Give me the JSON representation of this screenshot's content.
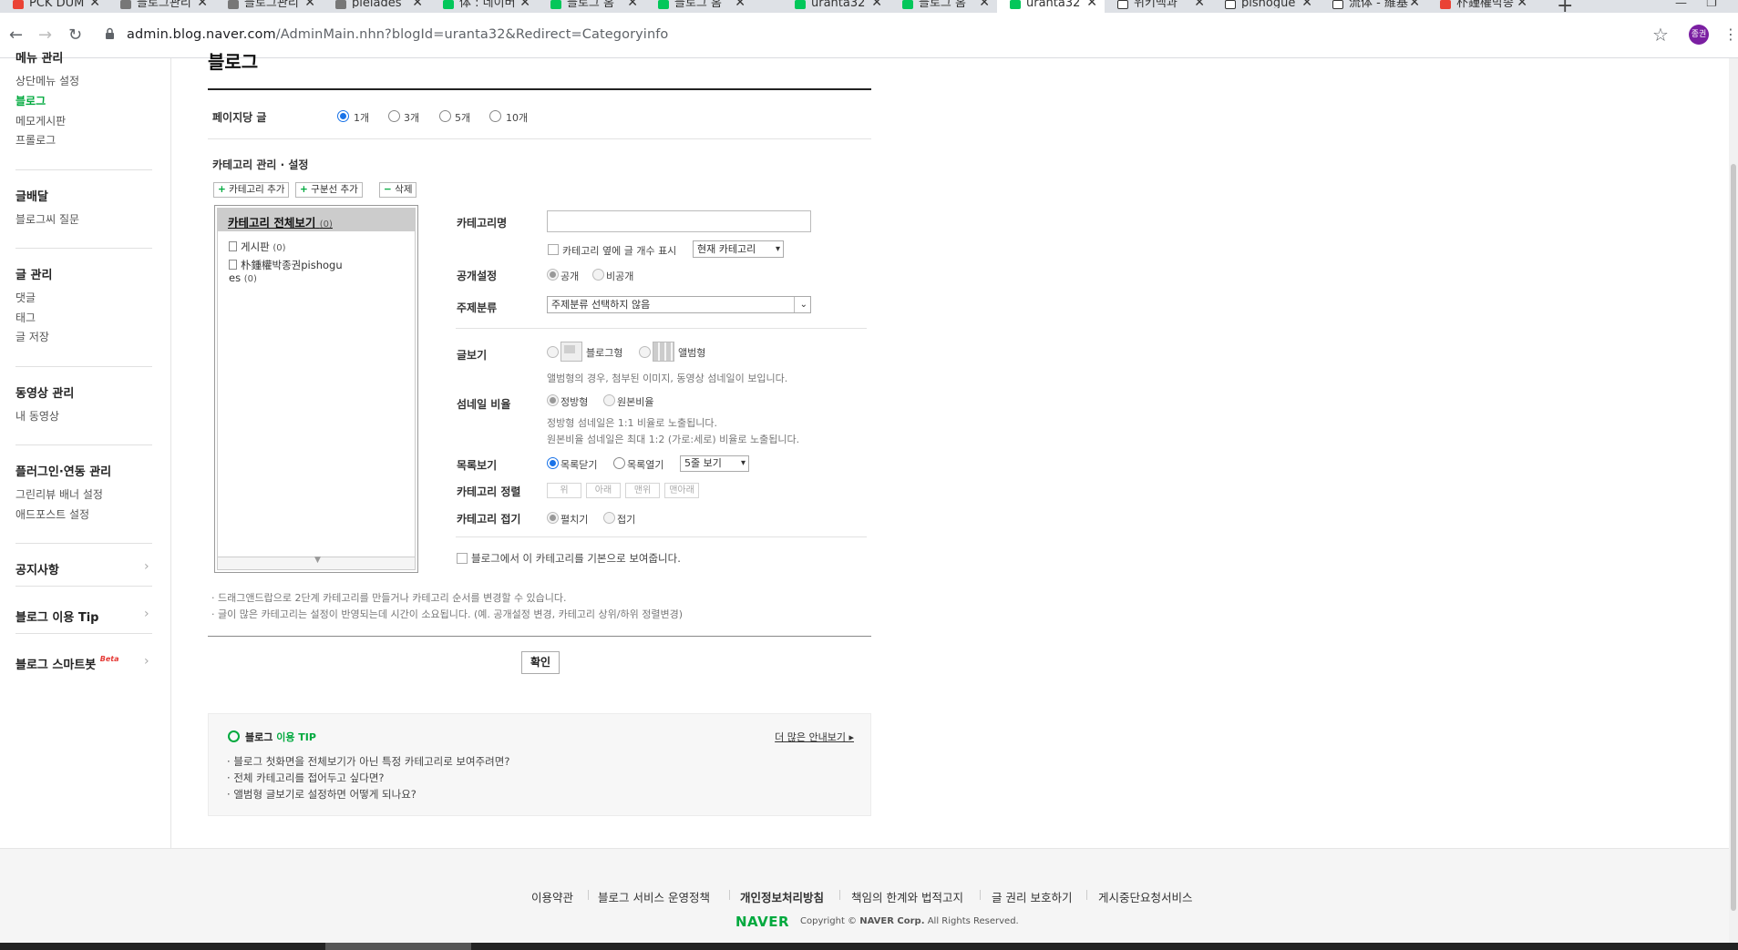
{
  "browser": {
    "tabs": [
      {
        "title": "PCK DUM",
        "favicon_color": "#ea4335"
      },
      {
        "title": "블로그관리",
        "favicon_color": "#666666"
      },
      {
        "title": "블로그관리",
        "favicon_color": "#666666"
      },
      {
        "title": "pleiades",
        "favicon_color": "#666666"
      },
      {
        "title": "体 : 네이버",
        "favicon_color": "#03c75a"
      },
      {
        "title": "블로그 홈",
        "favicon_color": "#03c75a"
      },
      {
        "title": "블로그 홈",
        "favicon_color": "#03c75a"
      },
      {
        "title": "uranta32",
        "favicon_color": "#03c75a"
      },
      {
        "title": "블로그 홈",
        "favicon_color": "#03c75a"
      },
      {
        "title": "uranta32",
        "favicon_color": "#03c75a"
      },
      {
        "title": "위키백과",
        "favicon_color": "#333333"
      },
      {
        "title": "pishogue",
        "favicon_color": "#333333"
      },
      {
        "title": "流体 - 維基",
        "favicon_color": "#333333"
      },
      {
        "title": "朴鍾權박종",
        "favicon_color": "#ea4335"
      }
    ],
    "active_tab_index": 9,
    "url_prefix": "admin.blog.naver.com",
    "url_rest": "/AdminMain.nhn?blogId=uranta32&Redirect=Categoryinfo",
    "profile_label": "종권"
  },
  "sidebar": {
    "section_menu": {
      "heading": "메뉴 관리",
      "items": [
        "상단메뉴 설정",
        "블로그",
        "메모게시판",
        "프롤로그"
      ]
    },
    "section_deliver": {
      "heading": "글배달",
      "items": [
        "블로그씨 질문"
      ]
    },
    "section_posts": {
      "heading": "글 관리",
      "items": [
        "댓글",
        "태그",
        "글 저장"
      ]
    },
    "section_video": {
      "heading": "동영상 관리",
      "items": [
        "내 동영상"
      ]
    },
    "section_plugin": {
      "heading": "플러그인·연동 관리",
      "items": [
        "그린리뷰 배너 설정",
        "애드포스트 설정"
      ]
    },
    "notice": "공지사항",
    "tip": "블로그 이용 Tip",
    "smartbot": "블로그 스마트봇",
    "smartbot_badge": "Beta"
  },
  "main": {
    "title": "블로그",
    "posts_per_page": {
      "label": "페이지당 글",
      "options": [
        "1개",
        "3개",
        "5개",
        "10개"
      ],
      "selected": "1개"
    },
    "category_section_title": "카테고리 관리 · 설정",
    "buttons": {
      "add_category": "카테고리 추가",
      "add_divider": "구분선 추가",
      "delete": "삭제"
    },
    "tree": {
      "root_label": "카테고리 전체보기",
      "root_count": "(0)",
      "items": [
        {
          "label": "게시판",
          "count": "(0)"
        },
        {
          "label": "朴鍾權박종권pishogu",
          "label2": "es",
          "count": "(0)"
        }
      ]
    },
    "form": {
      "name_label": "카테고리명",
      "name_value": "",
      "show_count_label": "카테고리 옆에 글 개수 표시",
      "show_count_select": "현재 카테고리",
      "visibility_label": "공개설정",
      "visibility_options": [
        "공개",
        "비공개"
      ],
      "topic_label": "주제분류",
      "topic_value": "주제분류 선택하지 않음",
      "view_label": "글보기",
      "view_options": [
        "블로그형",
        "앨범형"
      ],
      "view_note": "앨범형의 경우, 첨부된 이미지, 동영상 섬네일이 보입니다.",
      "thumb_label": "섬네일 비율",
      "thumb_options": [
        "정방형",
        "원본비율"
      ],
      "thumb_note1": "정방형 섬네일은 1:1 비율로 노출됩니다.",
      "thumb_note2": "원본비율 섬네일은 최대 1:2 (가로:세로) 비율로 노출됩니다.",
      "list_label": "목록보기",
      "list_options": [
        "목록닫기",
        "목록열기"
      ],
      "list_select": "5줄 보기",
      "sort_label": "카테고리 정렬",
      "sort_buttons": [
        "위",
        "아래",
        "맨위",
        "맨아래"
      ],
      "fold_label": "카테고리 접기",
      "fold_options": [
        "펼치기",
        "접기"
      ],
      "default_label": "블로그에서 이 카테고리를 기본으로 보여줍니다."
    },
    "notes": [
      "· 드래그앤드랍으로 2단계 카테고리를 만들거나 카테고리 순서를 변경할 수 있습니다.",
      "· 글이 많은 카테고리는 설정이 반영되는데 시간이 소요됩니다. (예. 공개설정 변경, 카테고리 상위/하위 정렬변경)"
    ],
    "confirm": "확인",
    "tip_box": {
      "title_prefix": "블로그",
      "title_suffix": "이용 TIP",
      "more": "더 많은 안내보기",
      "items": [
        "블로그 첫화면을 전체보기가 아닌 특정 카테고리로 보여주려면?",
        "전체 카테고리를 접어두고 싶다면?",
        "앨범형 글보기로 설정하면 어떻게 되나요?"
      ]
    }
  },
  "footer": {
    "links": [
      "이용약관",
      "블로그 서비스 운영정책",
      "개인정보처리방침",
      "책임의 한계와 법적고지",
      "글 권리 보호하기",
      "게시중단요청서비스"
    ],
    "brand": "NAVER",
    "copyright_prefix": "Copyright ©",
    "copyright_corp": "NAVER Corp.",
    "copyright_suffix": "All Rights Reserved."
  },
  "colors": {
    "accent_green": "#00a93e",
    "radio_blue": "#1a73e8"
  }
}
